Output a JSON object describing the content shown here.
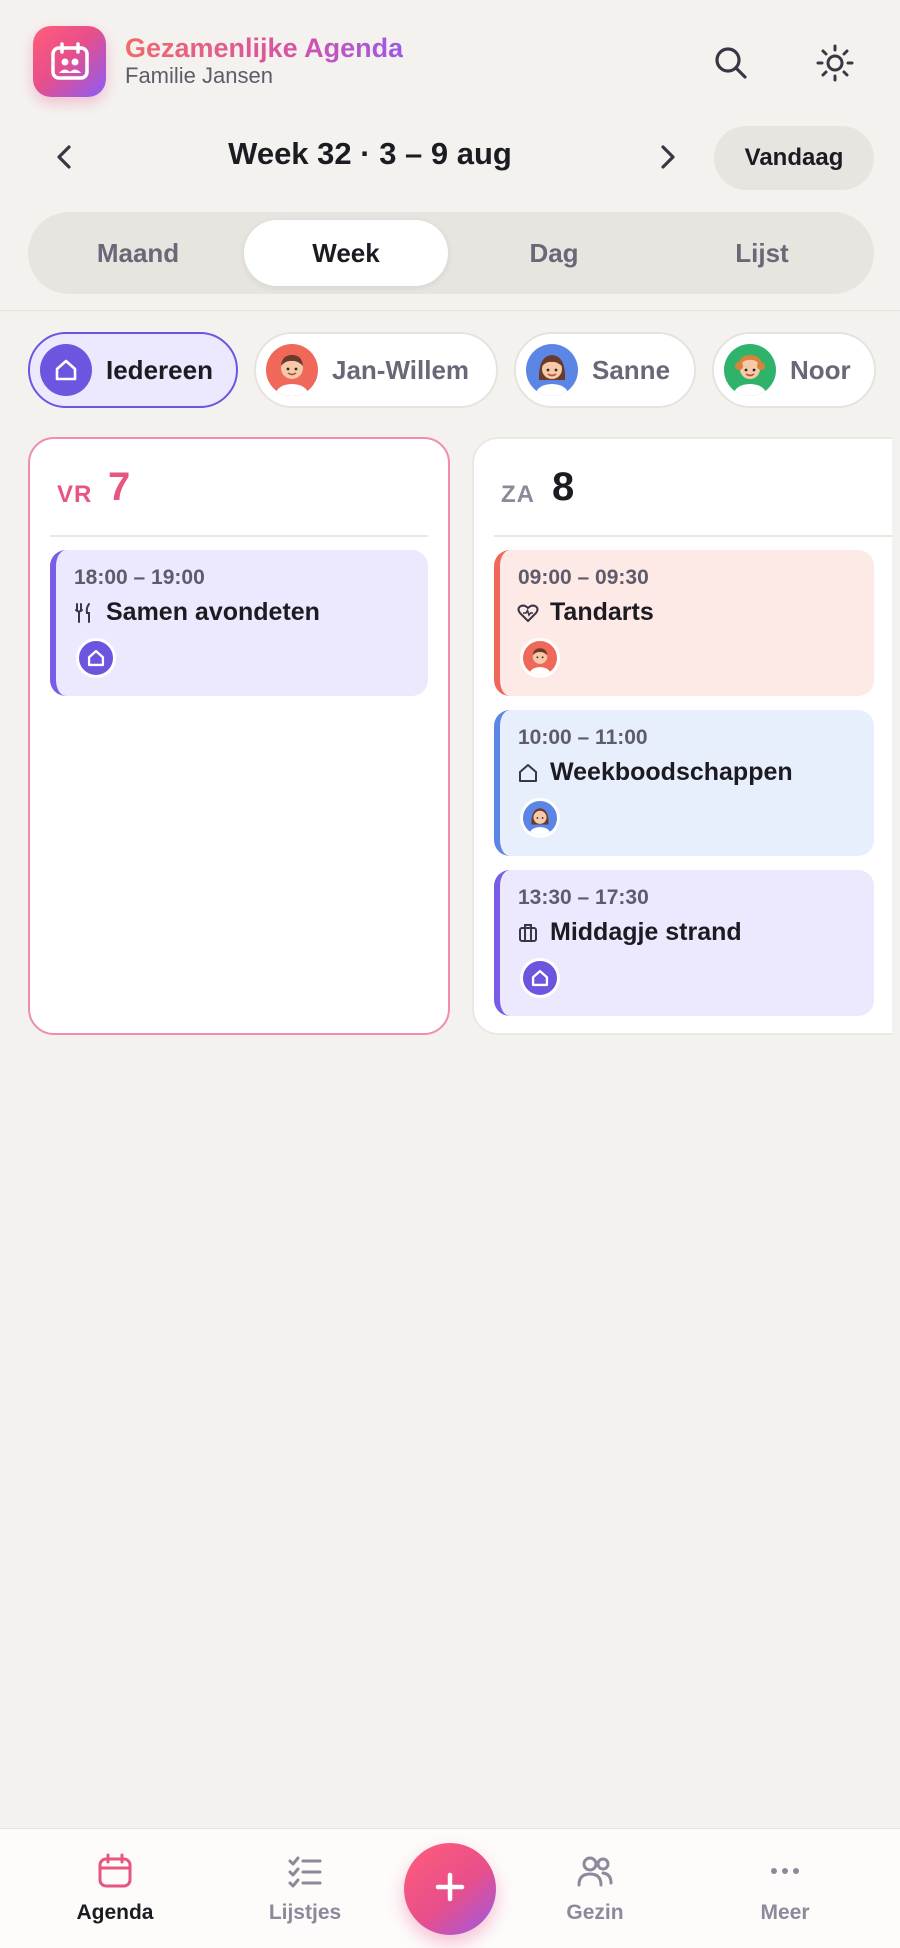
{
  "header": {
    "title": "Gezamenlijke Agenda",
    "subtitle": "Familie Jansen",
    "icons": [
      "calendar-icon",
      "search-icon",
      "sun-icon"
    ]
  },
  "week_nav": {
    "title": "Week 32 · 3 – 9 aug",
    "today_label": "Vandaag",
    "icons": [
      "chevron-left-icon",
      "chevron-right-icon"
    ]
  },
  "view_tabs": [
    {
      "label": "Maand",
      "active": false
    },
    {
      "label": "Week",
      "active": true
    },
    {
      "label": "Dag",
      "active": false
    },
    {
      "label": "Lijst",
      "active": false
    }
  ],
  "filters": [
    {
      "label": "Iedereen",
      "active": true,
      "avatar": "home-icon",
      "color": "#6d55e0"
    },
    {
      "label": "Jan-Willem",
      "active": false,
      "avatar": "avatar-jan-willem",
      "color": "#f0685a"
    },
    {
      "label": "Sanne",
      "active": false,
      "avatar": "avatar-sanne",
      "color": "#5b86e5"
    },
    {
      "label": "Noor",
      "active": false,
      "avatar": "avatar-noor",
      "color": "#2fb36b"
    }
  ],
  "days": [
    {
      "abbr": "VR",
      "number": "7",
      "is_today": true,
      "events": [
        {
          "time": "18:00 – 19:00",
          "title": "Samen avondeten",
          "icon": "utensils-icon",
          "member": "Iedereen",
          "color": "#7a5ce6"
        }
      ]
    },
    {
      "abbr": "ZA",
      "number": "8",
      "is_today": false,
      "events": [
        {
          "time": "09:00 – 09:30",
          "title": "Tandarts",
          "icon": "heart-icon",
          "member": "Jan-Willem",
          "color": "#f0685a"
        },
        {
          "time": "10:00 – 11:00",
          "title": "Weekboodschappen",
          "icon": "home-icon",
          "member": "Sanne",
          "color": "#5b86e5"
        },
        {
          "time": "13:30 – 17:30",
          "title": "Middagje strand",
          "icon": "suitcase-icon",
          "member": "Iedereen",
          "color": "#7a5ce6"
        }
      ]
    }
  ],
  "tabbar": {
    "items": [
      {
        "label": "Agenda",
        "icon": "calendar-icon",
        "active": true
      },
      {
        "label": "Lijstjes",
        "icon": "checklist-icon",
        "active": false
      },
      {
        "label": "Gezin",
        "icon": "people-icon",
        "active": false
      },
      {
        "label": "Meer",
        "icon": "more-icon",
        "active": false
      }
    ],
    "fab_icon": "plus-icon"
  },
  "colors": {
    "accent": "#e8557e",
    "primary": "#6d55e0",
    "background": "#f4f2ef"
  }
}
